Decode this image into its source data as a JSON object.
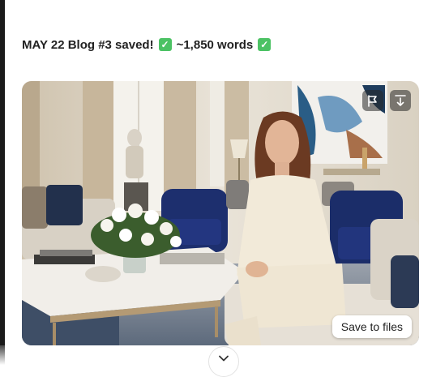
{
  "message": {
    "part1": "MAY 22 Blog #3 saved!",
    "check_icon": "white-check-mark-emoji",
    "part2": "~1,850 words"
  },
  "image": {
    "subject": "woman-in-cream-outfit-seated-in-elegant-living-room",
    "icons": [
      "flag-icon",
      "download-icon"
    ]
  },
  "buttons": {
    "save_label": "Save to files",
    "scroll_icon": "chevron-down-icon"
  },
  "colors": {
    "check_green": "#4cc264",
    "overlay_button": "#282828"
  }
}
